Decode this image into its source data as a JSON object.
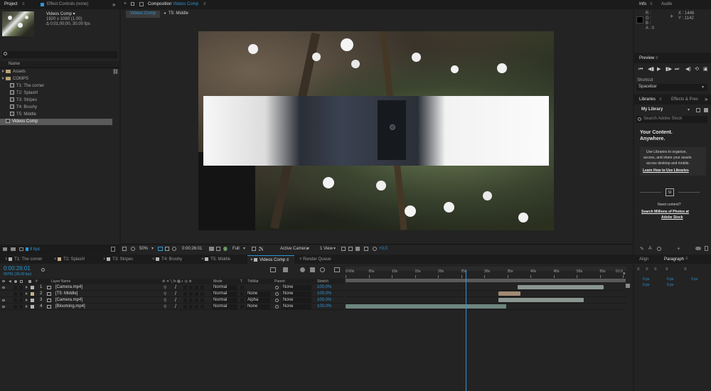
{
  "colors": {
    "accent": "#2f96d3",
    "label_sand": "#b9a271",
    "label_tan": "#c7b18c",
    "label_gray": "#b5b5b5",
    "bar_main": "#6e8580",
    "bar_sel": "#8b9691",
    "bar_peach": "#a08a72"
  },
  "project": {
    "tab_label": "Project",
    "effect_controls_label": "Effect Controls (none)",
    "item_name": "Videos Comp ▾",
    "item_resolution": "1920 x 1080 (1,00)",
    "item_duration": "Δ 0;01;00;00, 30,00 fps",
    "search_icon": "search-icon",
    "column_name": "Name",
    "items": [
      {
        "label": "Assets",
        "type": "folder",
        "indent": 0
      },
      {
        "label": "COMPS",
        "type": "folder",
        "indent": 0
      },
      {
        "label": "T1: The corner",
        "type": "comp",
        "indent": 1
      },
      {
        "label": "T2: Splash!",
        "type": "comp",
        "indent": 1
      },
      {
        "label": "T3: Stripes",
        "type": "comp",
        "indent": 1
      },
      {
        "label": "T4: Brushy",
        "type": "comp",
        "indent": 1
      },
      {
        "label": "T5: Middle",
        "type": "comp",
        "indent": 1
      },
      {
        "label": "Videos Comp",
        "type": "comp",
        "indent": 0,
        "selected": true
      }
    ],
    "bpc": "8 bpc"
  },
  "composition": {
    "tab_prefix": "Composition",
    "tab_name": "Videos Comp",
    "breadcrumbs": [
      "Videos Comp",
      "T5: Middle"
    ],
    "zoom": "50%",
    "timecode": "0:00:26:01",
    "resolution": "Full",
    "camera": "Active Camera",
    "view": "1 View",
    "exposure": "+0,0"
  },
  "info": {
    "tab_info": "Info",
    "tab_audio": "Audio",
    "r": "R :",
    "g": "G :",
    "b": "B :",
    "a": "A :  0",
    "x": "X : 1446",
    "y": "Y : 1142"
  },
  "preview": {
    "title": "Preview",
    "shortcut_label": "Shortcut",
    "shortcut_value": "Spacebar"
  },
  "libraries": {
    "tab_label": "Libraries",
    "tab_effects": "Effects & Pres",
    "library_select": "My Library",
    "search_placeholder": "Search Adobe Stock",
    "headline_1": "Your Content.",
    "headline_2": "Anywhere.",
    "body": [
      "Use Libraries to organize,",
      "access, and share your assets",
      "across desktop and mobile."
    ],
    "learn_link": "Learn How to Use Libraries",
    "stock_icon": "St",
    "need_content": "Need content?",
    "search_link_1": "Search Millions of Photos at",
    "search_link_2": "Adobe Stock"
  },
  "timeline_tabs": [
    {
      "label": "T1: The corner",
      "color": "#b5b5b5"
    },
    {
      "label": "T2: Splash!",
      "color": "#c7b18c"
    },
    {
      "label": "T3: Stripes",
      "color": "#b5b5b5"
    },
    {
      "label": "T4: Brushy",
      "color": "#b5b5b5"
    },
    {
      "label": "T5: Middle",
      "color": "#b5b5b5"
    },
    {
      "label": "Videos Comp",
      "color": "#b5b5b5",
      "active": true
    },
    {
      "label": "Render Queue",
      "color": ""
    }
  ],
  "timeline": {
    "timecode": "0:00:26:01",
    "frame_info": "00781 (30,00 fps)",
    "headers": {
      "layer_name": "Layer Name",
      "mode": "Mode",
      "t": "T",
      "trkmat": "TrkMat",
      "parent": "Parent",
      "stretch": "Stretch"
    },
    "layers": [
      {
        "num": "1",
        "name": "[Camera.mp4]",
        "color": "#b5b5b5",
        "mode": "Normal",
        "trkmat": "",
        "parent": "None",
        "stretch": "100,0%",
        "bar_start": 0.62,
        "bar_end": 0.93
      },
      {
        "num": "2",
        "name": "[T5: Middle]",
        "color": "#c7b18c",
        "mode": "Normal",
        "trkmat": "None",
        "parent": "None",
        "stretch": "100,0%",
        "bar_start": 0.55,
        "bar_end": 0.63
      },
      {
        "num": "3",
        "name": "[Camera.mp4]",
        "color": "#b5b5b5",
        "mode": "Normal",
        "trkmat": "Alpha",
        "parent": "None",
        "stretch": "100,0%",
        "bar_start": 0.55,
        "bar_end": 0.86
      },
      {
        "num": "4",
        "name": "[Blooming.mp4]",
        "color": "#b5b5b5",
        "mode": "Normal",
        "trkmat": "None",
        "parent": "None",
        "stretch": "100,0%",
        "bar_start": 0.0,
        "bar_end": 0.58
      }
    ],
    "ruler": [
      "0:00s",
      "05s",
      "10s",
      "15s",
      "20s",
      "25s",
      "30s",
      "35s",
      "40s",
      "45s",
      "50s",
      "55s",
      "01:0"
    ],
    "playhead": 0.434
  },
  "align": {
    "tab_align": "Align",
    "tab_paragraph": "Paragraph",
    "values": [
      "0 px",
      "0 px",
      "0 px",
      "0 px",
      "0 px"
    ]
  }
}
